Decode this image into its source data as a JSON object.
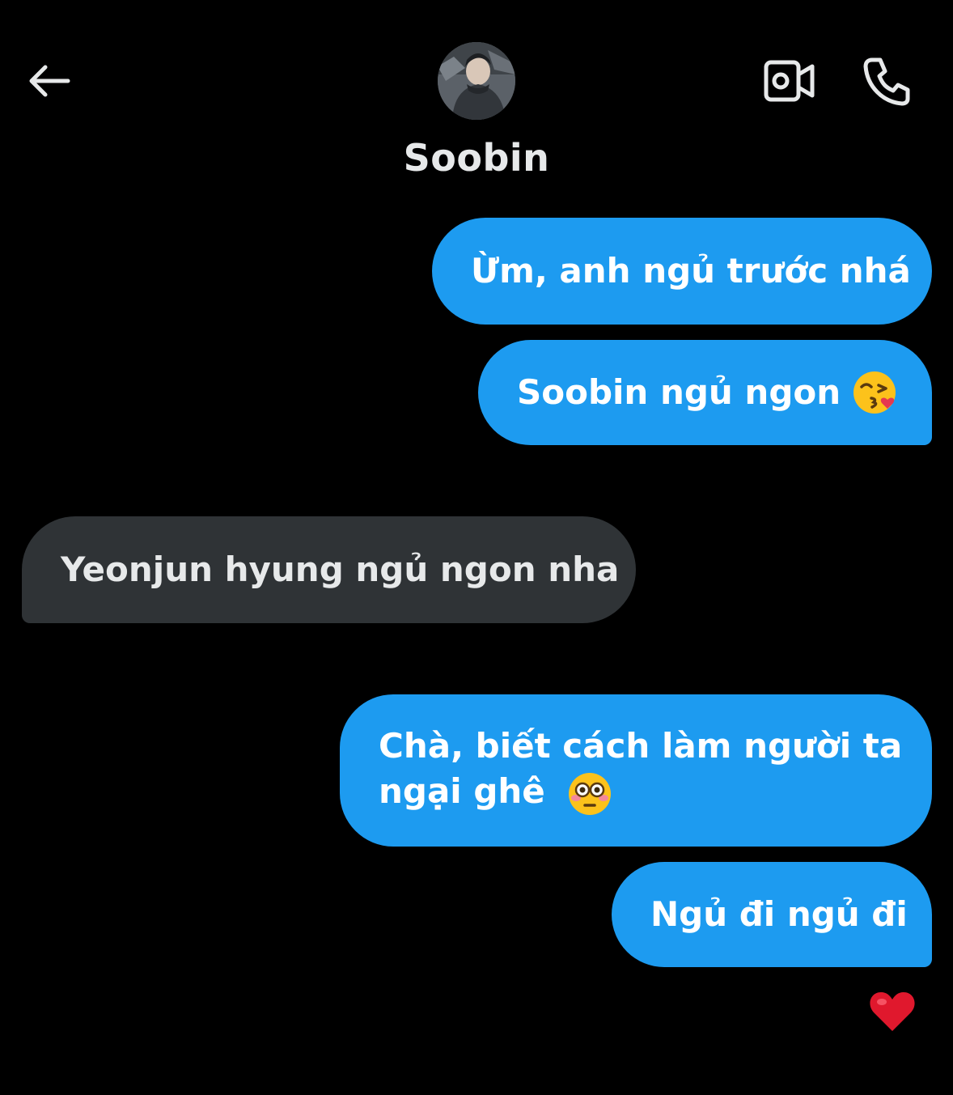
{
  "header": {
    "contact_name": "Soobin",
    "back_icon": "arrow-left-icon",
    "video_icon": "video-camera-icon",
    "call_icon": "phone-icon"
  },
  "messages": [
    {
      "direction": "sent",
      "text": "Ừm, anh ngủ trước nhá",
      "emoji": ""
    },
    {
      "direction": "sent",
      "text": "Soobin ngủ ngon",
      "emoji": "kissing-face-with-heart-emoji"
    },
    {
      "direction": "received",
      "text": "Yeonjun hyung ngủ ngon nha",
      "emoji": ""
    },
    {
      "direction": "sent",
      "text_line1": "Chà, biết cách làm người ta",
      "text_line2": "ngại ghê",
      "emoji": "flushed-face-emoji"
    },
    {
      "direction": "sent",
      "text": "Ngủ đi ngủ đi",
      "emoji": ""
    }
  ],
  "reaction": {
    "emoji": "red-heart-emoji"
  },
  "colors": {
    "background": "#000000",
    "sent_bubble": "#1d9bf0",
    "received_bubble": "#2f3336",
    "text": "#e7e9ea"
  }
}
